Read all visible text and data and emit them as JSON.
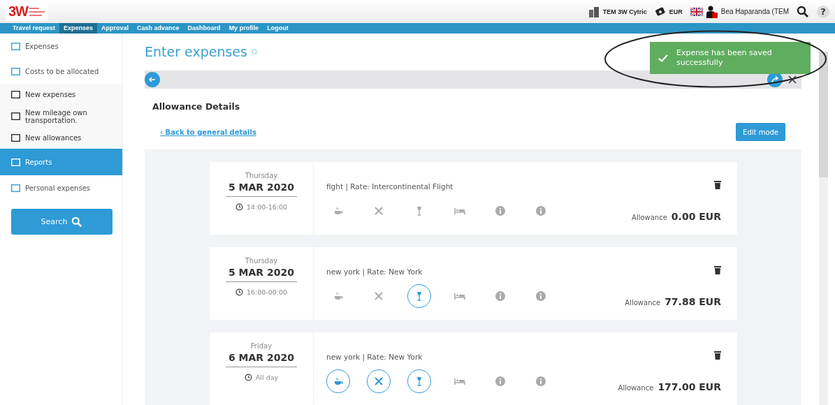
{
  "header": {
    "logo": "3W",
    "company": "TEM 3W Cytric",
    "currency": "EUR",
    "user": "Bea Haparanda (TEM",
    "help": "?"
  },
  "nav": [
    {
      "label": "Travel request",
      "selected": false
    },
    {
      "label": "Expenses",
      "selected": true
    },
    {
      "label": "Approval",
      "selected": false
    },
    {
      "label": "Cash advance",
      "selected": false
    },
    {
      "label": "Dashboard",
      "selected": false
    },
    {
      "label": "My profile",
      "selected": false
    },
    {
      "label": "Logout",
      "selected": false
    }
  ],
  "sidebar": {
    "items": [
      {
        "label": "Expenses",
        "kind": "section",
        "selected": false
      },
      {
        "label": "Costs to be allocated",
        "kind": "section",
        "selected": false
      },
      {
        "label": "New expenses",
        "kind": "sub",
        "selected": false
      },
      {
        "label": "New mileage own transportation.",
        "kind": "sub",
        "selected": false
      },
      {
        "label": "New allowances",
        "kind": "sub",
        "selected": false
      },
      {
        "label": "Reports",
        "kind": "section",
        "selected": true
      },
      {
        "label": "Personal expenses",
        "kind": "section",
        "selected": false
      }
    ],
    "search_button": "Search"
  },
  "page": {
    "title": "Enter expenses",
    "subtitle": "Allowance Details",
    "back_link": "‹ Back to general details",
    "edit_button": "Edit mode"
  },
  "toast": {
    "message": "Expense has been saved successfully"
  },
  "days": [
    {
      "weekday": "Thursday",
      "date": "5 MAR 2020",
      "time": "14:00-16:00",
      "description": "fight | Rate: Intercontinental Flight",
      "label": "Allowance",
      "amount": "0.00 EUR",
      "meals": [
        {
          "kind": "breakfast",
          "on": false
        },
        {
          "kind": "lunch",
          "on": false
        },
        {
          "kind": "dinner",
          "on": false
        },
        {
          "kind": "lodging",
          "on": false
        },
        {
          "kind": "info",
          "on": false
        },
        {
          "kind": "info",
          "on": false
        }
      ]
    },
    {
      "weekday": "Thursday",
      "date": "5 MAR 2020",
      "time": "16:00-00:00",
      "description": "new york | Rate: New York",
      "label": "Allowance",
      "amount": "77.88 EUR",
      "meals": [
        {
          "kind": "breakfast",
          "on": false
        },
        {
          "kind": "lunch",
          "on": false
        },
        {
          "kind": "dinner",
          "on": true
        },
        {
          "kind": "lodging",
          "on": false
        },
        {
          "kind": "info",
          "on": false
        },
        {
          "kind": "info",
          "on": false
        }
      ]
    },
    {
      "weekday": "Friday",
      "date": "6 MAR 2020",
      "time": "All day",
      "description": "new york | Rate: New York",
      "label": "Allowance",
      "amount": "177.00 EUR",
      "meals": [
        {
          "kind": "breakfast",
          "on": true
        },
        {
          "kind": "lunch",
          "on": true
        },
        {
          "kind": "dinner",
          "on": true
        },
        {
          "kind": "lodging",
          "on": false
        },
        {
          "kind": "info",
          "on": false
        },
        {
          "kind": "info",
          "on": false
        }
      ]
    }
  ]
}
